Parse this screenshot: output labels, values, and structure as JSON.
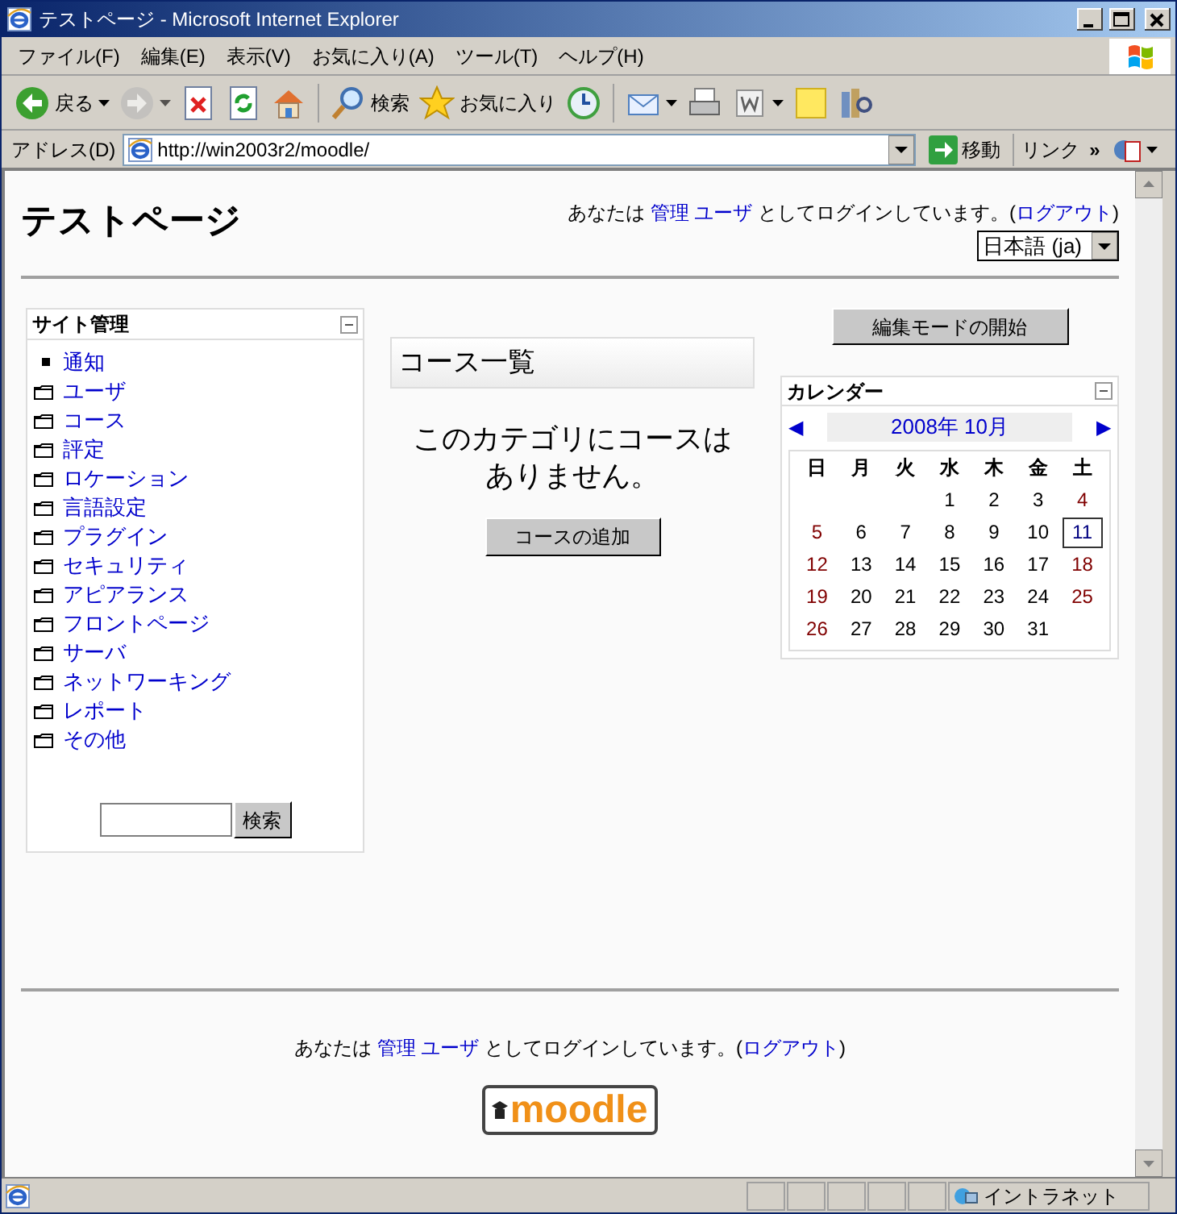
{
  "window": {
    "title": "テストページ - Microsoft Internet Explorer"
  },
  "menu": [
    "ファイル(F)",
    "編集(E)",
    "表示(V)",
    "お気に入り(A)",
    "ツール(T)",
    "ヘルプ(H)"
  ],
  "toolbar": [
    {
      "kind": "back",
      "label": "戻る",
      "menu": true,
      "disabled": false
    },
    {
      "kind": "forward",
      "menu": true,
      "disabled": true
    },
    {
      "kind": "stop",
      "menu": false,
      "disabled": false
    },
    {
      "kind": "refresh",
      "menu": false,
      "disabled": false
    },
    {
      "kind": "home",
      "menu": false,
      "disabled": false
    },
    {
      "kind": "search",
      "label": "検索",
      "menu": false,
      "disabled": false
    },
    {
      "kind": "favorites",
      "label": "お気に入り",
      "menu": false,
      "disabled": false
    },
    {
      "kind": "history",
      "menu": false,
      "disabled": false
    },
    {
      "kind": "mail",
      "menu": true,
      "disabled": false
    },
    {
      "kind": "print",
      "menu": false,
      "disabled": false
    },
    {
      "kind": "edit",
      "menu": true,
      "disabled": false
    },
    {
      "kind": "note",
      "menu": false,
      "disabled": false
    },
    {
      "kind": "research",
      "menu": false,
      "disabled": false
    }
  ],
  "address_bar": {
    "label": "アドレス(D)",
    "url": "http://win2003r2/moodle/",
    "go": "移動",
    "links": "リンク",
    "more": "»"
  },
  "page": {
    "title": "テストページ",
    "login": [
      {
        "kind": "text",
        "text": "あなたは "
      },
      {
        "kind": "link",
        "text": "管理 ユーザ"
      },
      {
        "kind": "text",
        "text": " としてログインしています。("
      },
      {
        "kind": "link",
        "text": "ログアウト"
      },
      {
        "kind": "text",
        "text": ")"
      }
    ],
    "language": "日本語 (ja)",
    "admin_block": {
      "title": "サイト管理",
      "items": [
        {
          "kind": "bullet",
          "label": "通知"
        },
        {
          "kind": "folder",
          "label": "ユーザ"
        },
        {
          "kind": "folder",
          "label": "コース"
        },
        {
          "kind": "folder",
          "label": "評定"
        },
        {
          "kind": "folder",
          "label": "ロケーション"
        },
        {
          "kind": "folder",
          "label": "言語設定"
        },
        {
          "kind": "folder",
          "label": "プラグイン"
        },
        {
          "kind": "folder",
          "label": "セキュリティ"
        },
        {
          "kind": "folder",
          "label": "アピアランス"
        },
        {
          "kind": "folder",
          "label": "フロントページ"
        },
        {
          "kind": "folder",
          "label": "サーバ"
        },
        {
          "kind": "folder",
          "label": "ネットワーキング"
        },
        {
          "kind": "folder",
          "label": "レポート"
        },
        {
          "kind": "folder",
          "label": "その他"
        }
      ],
      "search_button": "検索"
    },
    "courses": {
      "title": "コース一覧",
      "message": "このカテゴリにコースはありません。",
      "add_button": "コースの追加"
    },
    "edit_button": "編集モードの開始",
    "calendar": {
      "title": "カレンダー",
      "prev": "◀",
      "month": "2008年 10月",
      "next": "▶",
      "weekdays": [
        "日",
        "月",
        "火",
        "水",
        "木",
        "金",
        "土"
      ],
      "weeks": [
        [
          {
            "day": "1",
            "weekend": false,
            "today": false
          },
          {
            "day": "2",
            "weekend": false,
            "today": false
          },
          {
            "day": "3",
            "weekend": false,
            "today": false
          },
          {
            "day": "4",
            "weekend": true,
            "today": false
          }
        ],
        [
          {
            "day": "5",
            "weekend": true,
            "today": false
          },
          {
            "day": "6",
            "weekend": false,
            "today": false
          },
          {
            "day": "7",
            "weekend": false,
            "today": false
          },
          {
            "day": "8",
            "weekend": false,
            "today": false
          },
          {
            "day": "9",
            "weekend": false,
            "today": false
          },
          {
            "day": "10",
            "weekend": false,
            "today": false
          },
          {
            "day": "11",
            "weekend": false,
            "today": true
          }
        ],
        [
          {
            "day": "12",
            "weekend": true,
            "today": false
          },
          {
            "day": "13",
            "weekend": false,
            "today": false
          },
          {
            "day": "14",
            "weekend": false,
            "today": false
          },
          {
            "day": "15",
            "weekend": false,
            "today": false
          },
          {
            "day": "16",
            "weekend": false,
            "today": false
          },
          {
            "day": "17",
            "weekend": false,
            "today": false
          },
          {
            "day": "18",
            "weekend": true,
            "today": false
          }
        ],
        [
          {
            "day": "19",
            "weekend": true,
            "today": false
          },
          {
            "day": "20",
            "weekend": false,
            "today": false
          },
          {
            "day": "21",
            "weekend": false,
            "today": false
          },
          {
            "day": "22",
            "weekend": false,
            "today": false
          },
          {
            "day": "23",
            "weekend": false,
            "today": false
          },
          {
            "day": "24",
            "weekend": false,
            "today": false
          },
          {
            "day": "25",
            "weekend": true,
            "today": false
          }
        ],
        [
          {
            "day": "26",
            "weekend": true,
            "today": false
          },
          {
            "day": "27",
            "weekend": false,
            "today": false
          },
          {
            "day": "28",
            "weekend": false,
            "today": false
          },
          {
            "day": "29",
            "weekend": false,
            "today": false
          },
          {
            "day": "30",
            "weekend": false,
            "today": false
          },
          {
            "day": "31",
            "weekend": false,
            "today": false
          }
        ]
      ]
    },
    "footer_login": [
      {
        "kind": "text",
        "text": "あなたは "
      },
      {
        "kind": "link",
        "text": "管理 ユーザ"
      },
      {
        "kind": "text",
        "text": " としてログインしています。("
      },
      {
        "kind": "link",
        "text": "ログアウト"
      },
      {
        "kind": "text",
        "text": ")"
      }
    ],
    "logo": "moodle"
  },
  "status_bar": {
    "zone": "イントラネット"
  }
}
